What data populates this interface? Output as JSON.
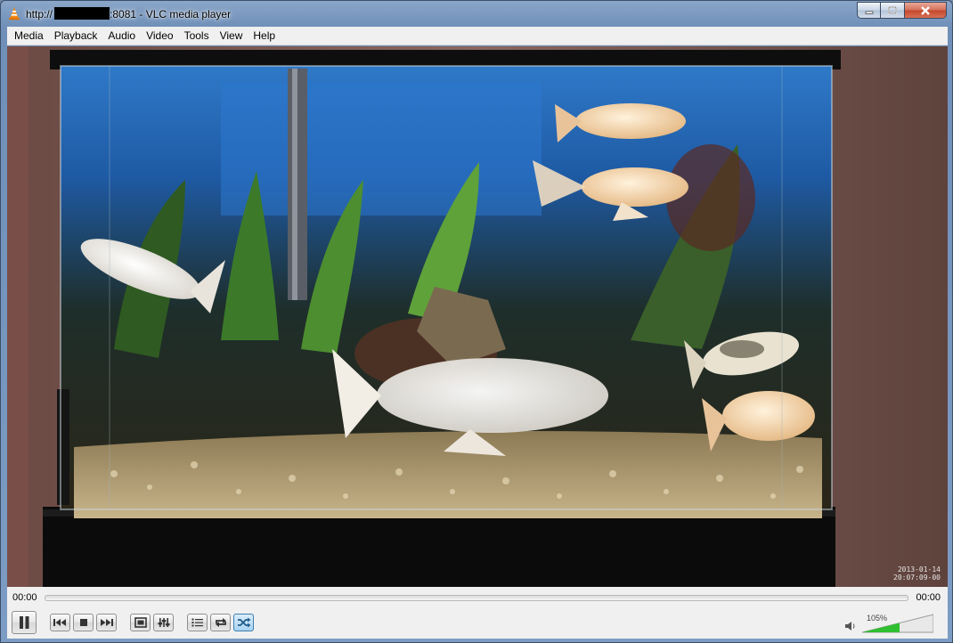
{
  "window": {
    "title_prefix": "http://",
    "title_suffix": ":8081 - VLC media player"
  },
  "menu": [
    "Media",
    "Playback",
    "Audio",
    "Video",
    "Tools",
    "View",
    "Help"
  ],
  "video": {
    "timestamp_date": "2013-01-14",
    "timestamp_time": "20:07:09-00"
  },
  "controls": {
    "elapsed": "00:00",
    "remaining": "00:00",
    "seek_progress": 0,
    "volume_label": "105%",
    "volume_level": 1.05,
    "shuffle_active": true
  },
  "icons": {
    "app": "vlc-cone-icon",
    "pause": "pause-icon",
    "prev": "previous-icon",
    "stop": "stop-icon",
    "next": "next-icon",
    "fullscreen": "fullscreen-icon",
    "ext": "extended-settings-icon",
    "playlist": "playlist-icon",
    "loop": "loop-icon",
    "shuffle": "shuffle-icon",
    "speaker": "speaker-icon"
  },
  "colors": {
    "accent": "#3c7fb1",
    "volume_fill": "#2fbf2f"
  }
}
